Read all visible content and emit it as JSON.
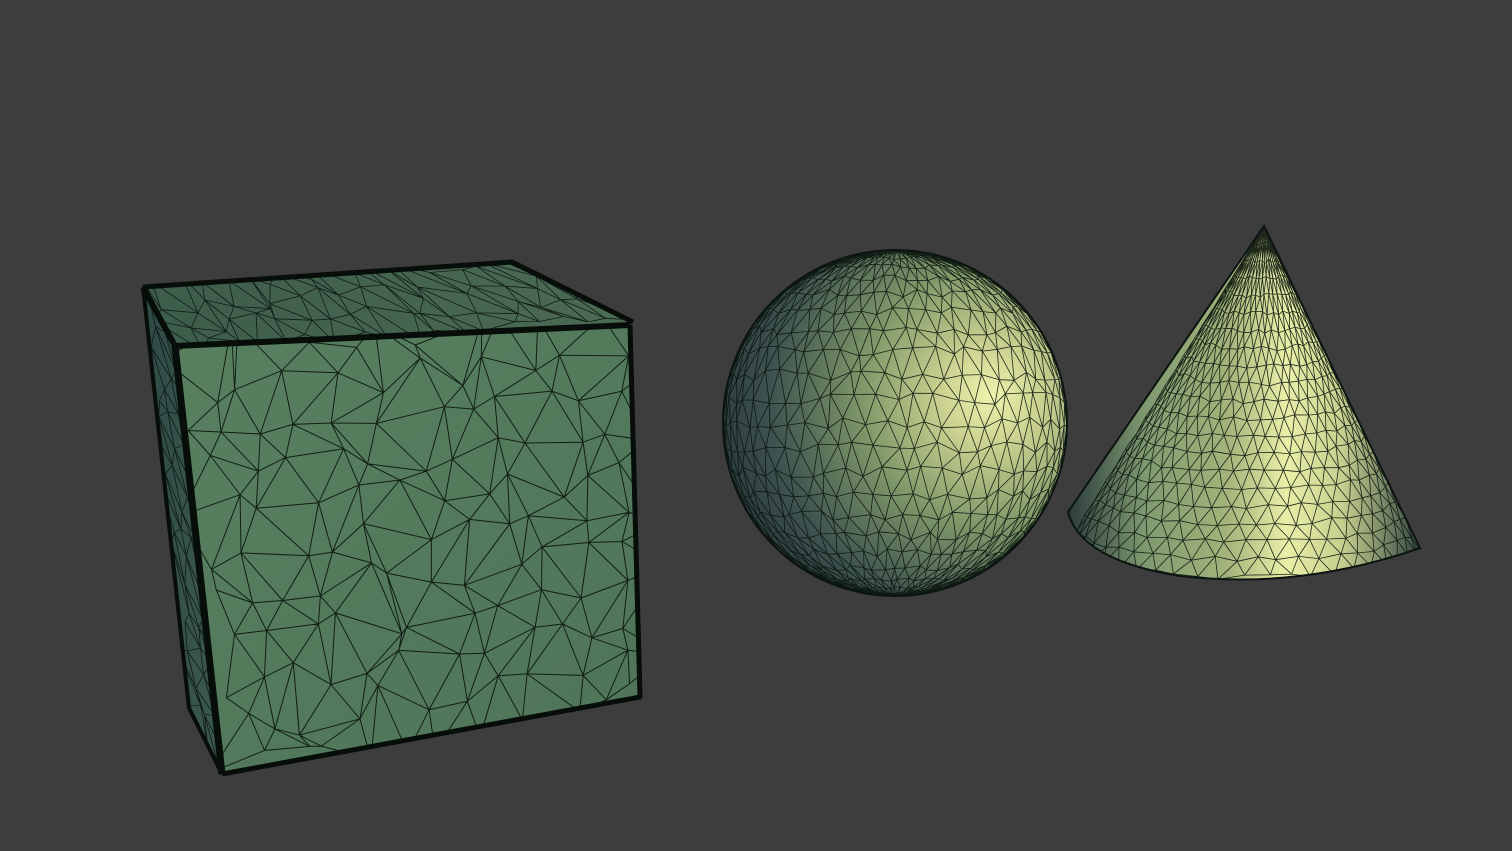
{
  "viewport": {
    "background": "#3d3d3d",
    "wireframe_color": "#0a140d"
  },
  "objects": [
    {
      "name": "cube",
      "kind": "box",
      "base_color": "#5a7f5d",
      "top_color": "#3f5f4d",
      "side_color": "#2f4a44"
    },
    {
      "name": "sphere",
      "kind": "sphere",
      "highlight_color": "#e6eda6",
      "mid_color": "#7f9a6a",
      "shadow_color": "#27363a"
    },
    {
      "name": "cone",
      "kind": "cone",
      "highlight_color": "#eef3a8",
      "mid_color": "#8ea66f",
      "shadow_color": "#2a3a3b"
    }
  ]
}
